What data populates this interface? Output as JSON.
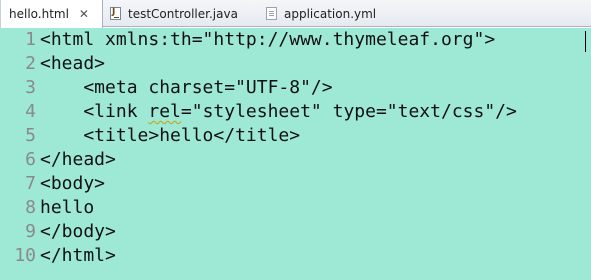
{
  "tabs": [
    {
      "label": "hello.html",
      "active": true,
      "close": "✕"
    },
    {
      "label": "testController.java",
      "active": false
    },
    {
      "label": "application.yml",
      "active": false
    }
  ],
  "editor": {
    "background": "#9ee8d6",
    "line_numbers": [
      "1",
      "2",
      "3",
      "4",
      "5",
      "6",
      "7",
      "8",
      "9",
      "10"
    ],
    "lines": [
      "<html xmlns:th=\"http://www.thymeleaf.org\">",
      "<head>",
      "    <meta charset=\"UTF-8\"/>",
      "    <link ",
      "rel",
      "=\"stylesheet\" type=\"text/css\"/>",
      "    <title>hello</title>",
      "</head>",
      "<body>",
      "hello",
      "</body>",
      "</html>"
    ]
  }
}
